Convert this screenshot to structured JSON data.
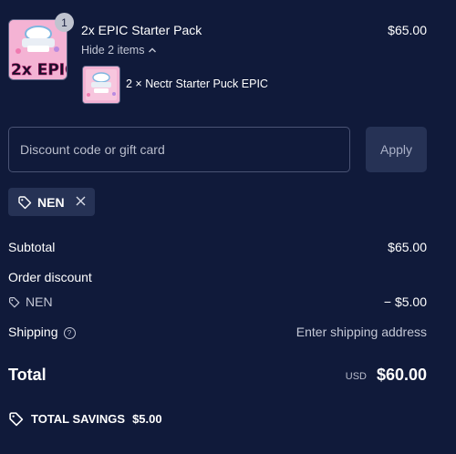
{
  "product": {
    "quantity_badge": "1",
    "title": "2x EPIC Starter Pack",
    "price": "$65.00",
    "thumb_text": "2x EPIC",
    "hide_items_label": "Hide 2 items",
    "sub_item_label": "2 × Nectr Starter Puck EPIC"
  },
  "discount": {
    "placeholder": "Discount code or gift card",
    "apply_label": "Apply",
    "applied_code": "NEN"
  },
  "summary": {
    "subtotal_label": "Subtotal",
    "subtotal_value": "$65.00",
    "order_discount_label": "Order discount",
    "discount_code": "NEN",
    "discount_value": "− $5.00",
    "shipping_label": "Shipping",
    "shipping_value": "Enter shipping address",
    "total_label": "Total",
    "currency": "USD",
    "total_value": "$60.00",
    "savings_label": "TOTAL SAVINGS",
    "savings_value": "$5.00"
  },
  "colors": {
    "background": "#101a3a",
    "button_bg": "#263255",
    "product_pink": "#f4b3d4"
  }
}
